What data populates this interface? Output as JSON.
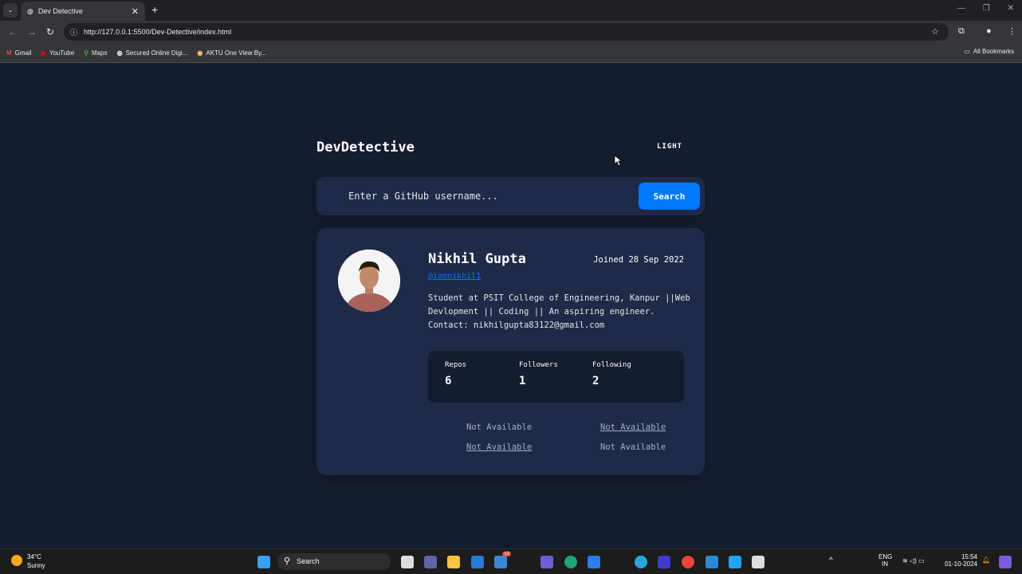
{
  "browser": {
    "tab_title": "Dev Detective",
    "url": "http://127.0.0.1:5500/Dev-Detective/index.html",
    "bookmarks": [
      "Gmail",
      "YouTube",
      "Maps",
      "Secured Online Digi...",
      "AKTU One View By..."
    ],
    "all_bookmarks": "All Bookmarks"
  },
  "app": {
    "logo": "DevDetective",
    "mode_toggle": "LIGHT",
    "search_placeholder": "Enter a GitHub username...",
    "search_button": "Search"
  },
  "profile": {
    "name": "Nikhil Gupta",
    "joined": "Joined 28 Sep 2022",
    "username": "@iamnikhil1",
    "bio": "Student at PSIT College of Engineering, Kanpur ||Web Devlopment || Coding || An aspiring engineer. Contact: nikhilgupta83122@gmail.com",
    "stats": [
      {
        "label": "Repos",
        "value": "6"
      },
      {
        "label": "Followers",
        "value": "1"
      },
      {
        "label": "Following",
        "value": "2"
      }
    ],
    "links": {
      "location": "Not Available",
      "website": "Not Available",
      "twitter": "Not Available",
      "company": "Not Available"
    }
  },
  "taskbar": {
    "temp": "34°C",
    "weather": "Sunny",
    "search": "Search",
    "lang": "ENG",
    "region": "IN",
    "time": "15:54",
    "date": "01-10-2024",
    "mail_badge": "13"
  }
}
